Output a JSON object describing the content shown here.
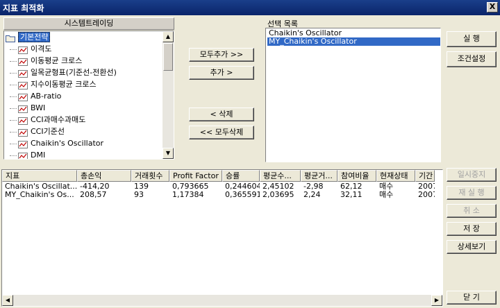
{
  "window": {
    "title": "지표 최적화",
    "close_label": "X"
  },
  "tree": {
    "header": "시스템트레이딩",
    "root": "기본전략",
    "items": [
      "이격도",
      "이동평균 크로스",
      "일목균형표(기준선-전환선)",
      "지수이동평균 크로스",
      "AB-ratio",
      "BWI",
      "CCI과매수과매도",
      "CCI기준선",
      "Chaikin's Oscillator",
      "DMI"
    ]
  },
  "buttons": {
    "add_all": "모두추가 >>",
    "add": "추가 >",
    "remove": "< 삭제",
    "remove_all": "<< 모두삭제",
    "run": "실 행",
    "condition": "조건설정",
    "pause": "일시중지",
    "rerun": "재 실 행",
    "cancel": "취 소",
    "save": "저 장",
    "detail": "상세보기",
    "close": "닫 기"
  },
  "selection": {
    "label": "선택 목록",
    "items": [
      "Chaikin's Oscillator",
      "MY_Chaikin's Oscillator"
    ]
  },
  "grid": {
    "columns": [
      "지표",
      "총손익",
      "거래횟수",
      "Profit Factor",
      "승률",
      "평균수...",
      "평균거...",
      "참여비율",
      "현재상태",
      "기간"
    ],
    "rows": [
      [
        "Chaikin's Oscillat...",
        "-414,20",
        "139",
        "0,793665",
        "0,244604",
        "2,45102",
        "-2,98",
        "62,12",
        "매수",
        "2007"
      ],
      [
        "MY_Chaikin's Os...",
        "208,57",
        "93",
        "1,17384",
        "0,365591",
        "2,03695",
        "2,24",
        "32,11",
        "매수",
        "2007"
      ]
    ]
  },
  "colors": {
    "selection": "#3169c6",
    "title_bar": "#0a246a",
    "icon_red": "#c00000"
  }
}
